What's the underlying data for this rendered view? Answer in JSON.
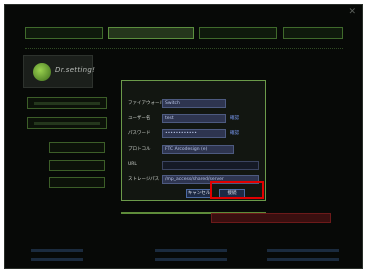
{
  "window": {
    "close_glyph": "✕"
  },
  "logo": {
    "text": "Dr.setting!"
  },
  "dialog": {
    "rows": [
      {
        "label": "ファイアウォール",
        "value": "Switch"
      },
      {
        "label": "ユーザー名",
        "value": "test",
        "link": "確認"
      },
      {
        "label": "パスワード",
        "value": "••••••••••••",
        "link": "確認"
      },
      {
        "label": "プロトコル",
        "value": "FTC Arcodesign (e)"
      },
      {
        "label": "URL",
        "value": ""
      },
      {
        "label": "ストレージパス",
        "value": "/mp_access/shared/server"
      }
    ],
    "cancel_label": "キャンセル",
    "ok_label": "接続"
  }
}
